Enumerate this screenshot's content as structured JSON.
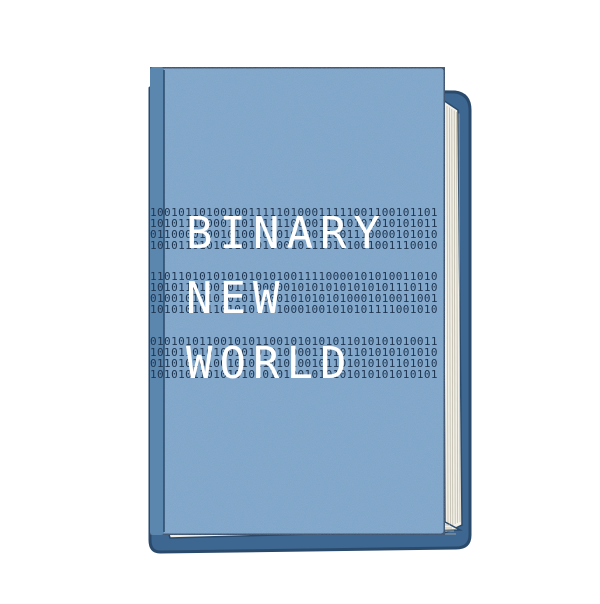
{
  "book": {
    "title_lines": [
      "BINARY",
      "NEW",
      "WORLD"
    ],
    "binary_rows": [
      "10010110100100111110100011111001100101101",
      "10101110000110101111000011110101010101011",
      "01100001001010010101010011001110000101010",
      "10101101010010101000101110101001001110010",
      "11011010101010101010011110000101010011010",
      "10101101001011100000101010101010101110110",
      "01001010101010100001010101010001010011001",
      "10101010110101011110001001010101111001010",
      "01010101100101011001010101011010101010011",
      "10101101010010101010000110101101010101010",
      "01101010100101011010100101101010101101010",
      "10101011010101010101001010101010101010101"
    ],
    "colors": {
      "cover": "#7ba6cc",
      "cover_dark": "#5b87af",
      "back_board": "#3d6690",
      "outline": "#2a4a6b",
      "pages": "#f1efe6",
      "title": "#ffffff",
      "binary": "#1f3550"
    }
  }
}
